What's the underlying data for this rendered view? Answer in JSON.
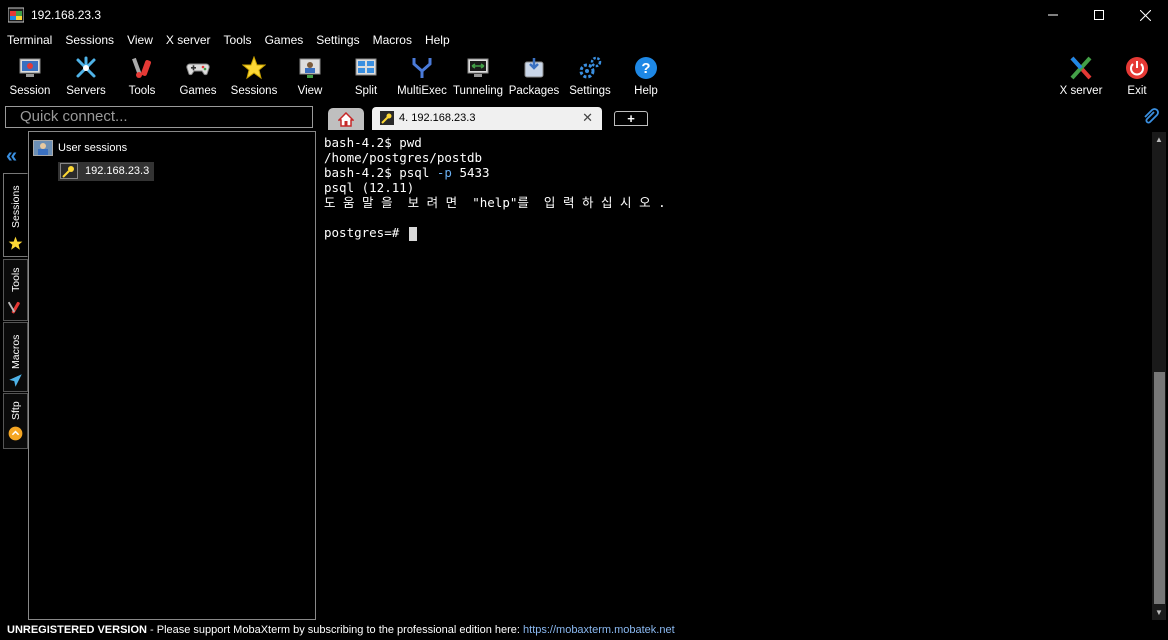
{
  "window": {
    "title": "192.168.23.3",
    "minimize": "—",
    "maximize": "☐",
    "close": "✕"
  },
  "menu": [
    "Terminal",
    "Sessions",
    "View",
    "X server",
    "Tools",
    "Games",
    "Settings",
    "Macros",
    "Help"
  ],
  "toolbar": {
    "session": "Session",
    "servers": "Servers",
    "tools": "Tools",
    "games": "Games",
    "sessions": "Sessions",
    "view": "View",
    "split": "Split",
    "multiexec": "MultiExec",
    "tunneling": "Tunneling",
    "packages": "Packages",
    "settings": "Settings",
    "help": "Help",
    "xserver": "X server",
    "exit": "Exit"
  },
  "quick_connect": {
    "placeholder": "Quick connect..."
  },
  "tabs": {
    "session_label": "4. 192.168.23.3",
    "close": "✕",
    "new": "+"
  },
  "side_tabs": {
    "sessions": "Sessions",
    "tools": "Tools",
    "macros": "Macros",
    "sftp": "Sftp"
  },
  "panel": {
    "group": "User sessions",
    "session": "192.168.23.3"
  },
  "terminal": {
    "line1": "bash-4.2$ pwd",
    "line2": "/home/postgres/postdb",
    "line3_pre": "bash-4.2$ psql ",
    "line3_flag": "-p",
    "line3_post": " 5433",
    "line4": "psql (12.11)",
    "line5": "도 움 말 을  보 려 면  \"help\"를  입 력 하 십 시 오 .",
    "line6": "postgres=# "
  },
  "status": {
    "unregistered": "UNREGISTERED VERSION",
    "message": "  -  Please support MobaXterm by subscribing to the professional edition here:  ",
    "link": "https://mobaxterm.mobatek.net"
  },
  "colors": {
    "accent_blue": "#3a8fe0",
    "flag_blue": "#6ab0f3",
    "exit_red": "#e53935",
    "help_blue": "#1e88e5"
  }
}
